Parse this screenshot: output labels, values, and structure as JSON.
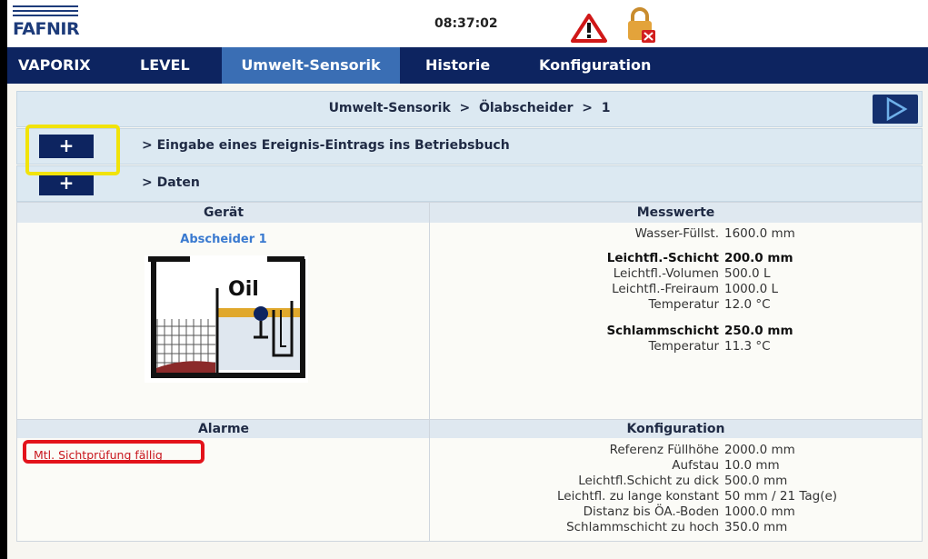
{
  "header": {
    "logo": "FAFNIR",
    "time": "08:37:02"
  },
  "nav": {
    "tabs": [
      "VAPORIX",
      "LEVEL",
      "Umwelt-Sensorik",
      "Historie",
      "Konfiguration"
    ],
    "active": "Umwelt-Sensorik"
  },
  "breadcrumb": {
    "path": "Umwelt-Sensorik  >  Ölabscheider  >  1"
  },
  "rows": [
    {
      "plus": "+",
      "label": "> Eingabe eines Ereignis-Eintrags ins Betriebsbuch"
    },
    {
      "plus": "+",
      "label": "> Daten"
    }
  ],
  "device": {
    "header": "Gerät",
    "name": "Abscheider 1",
    "tank_label": "Oil"
  },
  "measurements": {
    "header": "Messwerte",
    "items": [
      {
        "key": "Wasser-Füllst.",
        "value": "1600.0 mm",
        "bold": false
      },
      {
        "key": "Leichtfl.-Schicht",
        "value": "200.0 mm",
        "bold": true
      },
      {
        "key": "Leichtfl.-Volumen",
        "value": "500.0 L",
        "bold": false
      },
      {
        "key": "Leichtfl.-Freiraum",
        "value": "1000.0 L",
        "bold": false
      },
      {
        "key": "Temperatur",
        "value": "12.0 °C",
        "bold": false
      },
      {
        "key": "Schlammschicht",
        "value": "250.0 mm",
        "bold": true
      },
      {
        "key": "Temperatur",
        "value": "11.3 °C",
        "bold": false
      }
    ]
  },
  "alarms": {
    "header": "Alarme",
    "items": [
      "Mtl. Sichtprüfung fällig"
    ]
  },
  "configuration": {
    "header": "Konfiguration",
    "items": [
      {
        "key": "Referenz Füllhöhe",
        "value": "2000.0 mm"
      },
      {
        "key": "Aufstau",
        "value": "10.0 mm"
      },
      {
        "key": "Leichtfl.Schicht zu dick",
        "value": "500.0 mm"
      },
      {
        "key": "Leichtfl. zu lange konstant",
        "value": "50 mm / 21 Tag(e)"
      },
      {
        "key": "Distanz bis ÖA.-Boden",
        "value": "1000.0 mm"
      },
      {
        "key": "Schlammschicht zu hoch",
        "value": "350.0 mm"
      }
    ]
  },
  "colors": {
    "nav": "#0d2460",
    "active_tab": "#3a6eb4",
    "alarm": "#e3131b",
    "highlight": "#f1e30b"
  }
}
